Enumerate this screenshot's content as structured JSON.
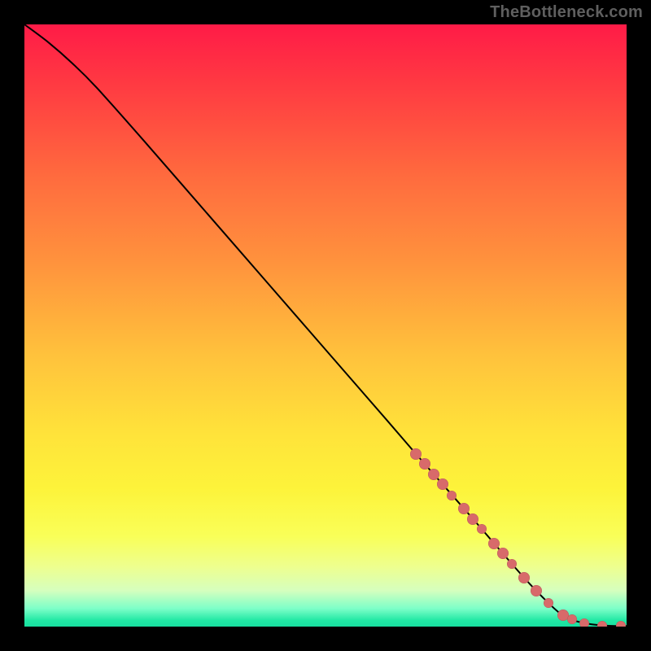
{
  "watermark": "TheBottleneck.com",
  "colors": {
    "marker": "#d86a6a",
    "curve": "#000000"
  },
  "chart_data": {
    "type": "line",
    "title": "",
    "xlabel": "",
    "ylabel": "",
    "xlim": [
      0,
      100
    ],
    "ylim": [
      0,
      100
    ],
    "grid": false,
    "legend": false,
    "series": [
      {
        "name": "bottleneck-curve",
        "x": [
          0,
          4,
          8,
          12,
          20,
          30,
          40,
          50,
          60,
          65,
          70,
          75,
          80,
          84,
          88,
          90,
          92,
          94,
          96,
          98,
          100
        ],
        "y": [
          100,
          97,
          93.5,
          89.5,
          80.5,
          69,
          57.5,
          46,
          34.5,
          28.7,
          23,
          17.3,
          11.5,
          7,
          3,
          1.5,
          0.8,
          0.4,
          0.2,
          0.1,
          0.1
        ]
      }
    ],
    "markers": [
      {
        "x": 65,
        "y": 28.7,
        "r": 7
      },
      {
        "x": 66.5,
        "y": 27,
        "r": 7
      },
      {
        "x": 68,
        "y": 25.3,
        "r": 7
      },
      {
        "x": 69.5,
        "y": 23.6,
        "r": 7
      },
      {
        "x": 71,
        "y": 21.8,
        "r": 6
      },
      {
        "x": 73,
        "y": 19.6,
        "r": 7
      },
      {
        "x": 74.5,
        "y": 17.9,
        "r": 7
      },
      {
        "x": 76,
        "y": 16.2,
        "r": 6
      },
      {
        "x": 78,
        "y": 13.8,
        "r": 7
      },
      {
        "x": 79.5,
        "y": 12.1,
        "r": 7
      },
      {
        "x": 81,
        "y": 10.4,
        "r": 6
      },
      {
        "x": 83,
        "y": 8.1,
        "r": 7
      },
      {
        "x": 85,
        "y": 5.9,
        "r": 7
      },
      {
        "x": 87,
        "y": 3.9,
        "r": 6
      },
      {
        "x": 89.5,
        "y": 1.9,
        "r": 7
      },
      {
        "x": 91,
        "y": 1.2,
        "r": 6
      },
      {
        "x": 93,
        "y": 0.6,
        "r": 6
      },
      {
        "x": 96,
        "y": 0.2,
        "r": 6
      },
      {
        "x": 99,
        "y": 0.1,
        "r": 6
      }
    ]
  }
}
